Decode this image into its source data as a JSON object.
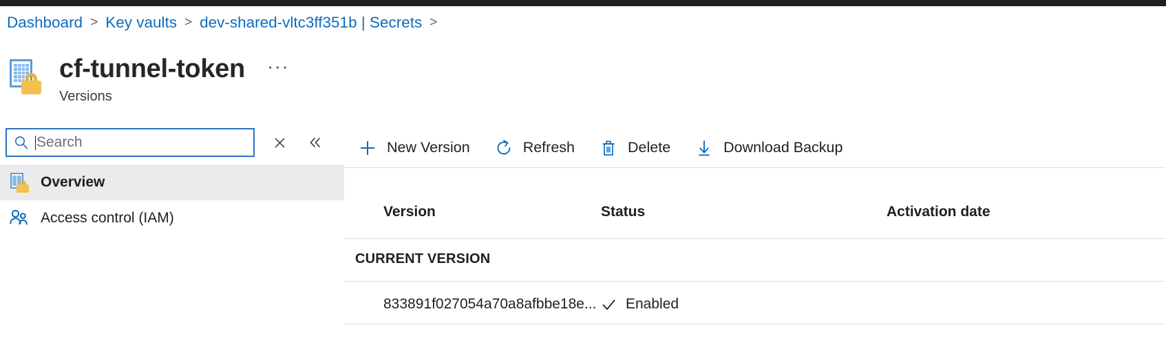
{
  "breadcrumb": {
    "items": [
      {
        "label": "Dashboard"
      },
      {
        "label": "Key vaults"
      },
      {
        "label": "dev-shared-vltc3ff351b | Secrets"
      }
    ],
    "separator": ">"
  },
  "header": {
    "title": "cf-tunnel-token",
    "subtitle": "Versions",
    "more_label": "···",
    "icon": "key-vault-secret-icon"
  },
  "search": {
    "placeholder": "Search",
    "value": "",
    "icon": "search-icon",
    "clear_label": "×",
    "collapse_label": "«"
  },
  "sidebar": {
    "items": [
      {
        "label": "Overview",
        "icon": "key-vault-secret-icon",
        "selected": true
      },
      {
        "label": "Access control (IAM)",
        "icon": "people-icon",
        "selected": false
      }
    ]
  },
  "toolbar": {
    "commands": [
      {
        "label": "New Version",
        "icon": "plus-icon"
      },
      {
        "label": "Refresh",
        "icon": "refresh-icon"
      },
      {
        "label": "Delete",
        "icon": "trash-icon"
      },
      {
        "label": "Download Backup",
        "icon": "download-icon"
      }
    ]
  },
  "table": {
    "columns": [
      "Version",
      "Status",
      "Activation date"
    ],
    "group_label": "CURRENT VERSION",
    "rows": [
      {
        "version": "833891f027054a70a8afbbe18e...",
        "status": "Enabled",
        "status_icon": "checkmark-icon",
        "activation_date": ""
      }
    ]
  },
  "colors": {
    "accent": "#0f6cbd",
    "link": "#0f6cbd",
    "selected_row_bg": "#ebebeb",
    "lock_yellow": "#f2c14e",
    "vault_blue": "#5b9bd5",
    "top_bar": "#1f1f1f"
  }
}
